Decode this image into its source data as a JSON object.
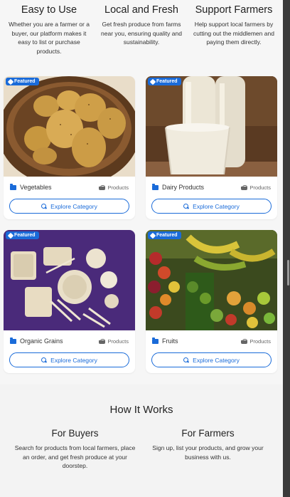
{
  "features": [
    {
      "title": "Easy to Use",
      "text": "Whether you are a farmer or a buyer, our platform makes it easy to list or purchase products."
    },
    {
      "title": "Local and Fresh",
      "text": "Get fresh produce from farms near you, ensuring quality and sustainability."
    },
    {
      "title": "Support Farmers",
      "text": "Help support local farmers by cutting out the middlemen and paying them directly."
    }
  ],
  "badge_label": "Featured",
  "cards": [
    {
      "category": "Vegetables",
      "products_label": "Products",
      "button": "Explore Category"
    },
    {
      "category": "Dairy Products",
      "products_label": "Products",
      "button": "Explore Category"
    },
    {
      "category": "Organic Grains",
      "products_label": "Products",
      "button": "Explore Category"
    },
    {
      "category": "Fruits",
      "products_label": "Products",
      "button": "Explore Category"
    }
  ],
  "how": {
    "title": "How It Works",
    "buyers": {
      "title": "For Buyers",
      "text": "Search for products from local farmers, place an order, and get fresh produce at your doorstep."
    },
    "farmers": {
      "title": "For Farmers",
      "text": "Sign up, list your products, and grow your business with us."
    }
  },
  "colors": {
    "accent": "#1a6bd9"
  }
}
